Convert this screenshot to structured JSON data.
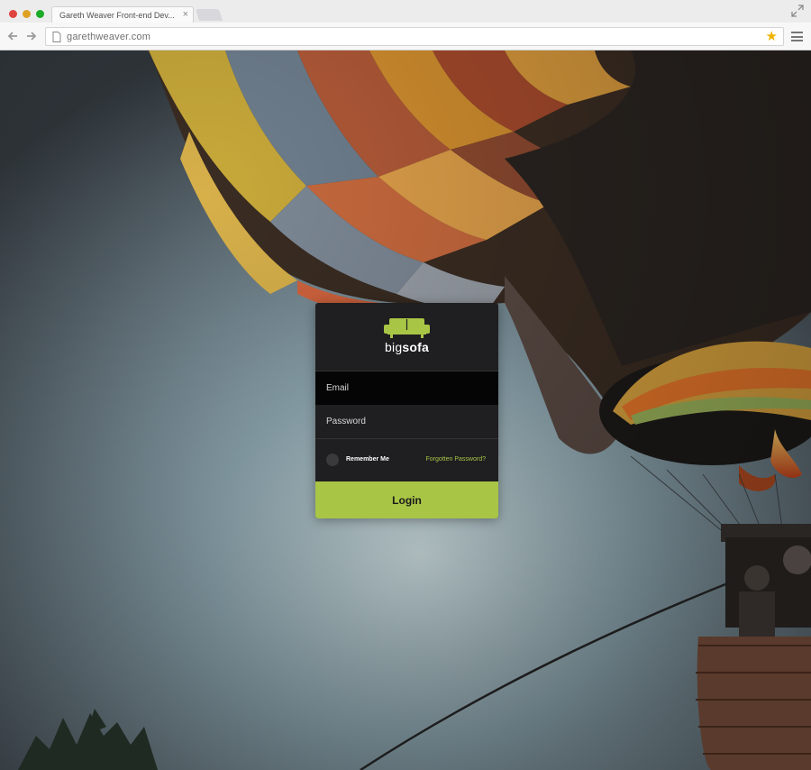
{
  "browser": {
    "tab_title": "Gareth Weaver Front-end Dev...",
    "tab_close": "×",
    "url": "garethweaver.com",
    "bookmark_icon": "star-icon",
    "star_glyph": "★",
    "accent_star": "#f0b400"
  },
  "login": {
    "brand_prefix": "big",
    "brand_suffix": "sofa",
    "email_placeholder": "Email",
    "password_placeholder": "Password",
    "remember_label": "Remember Me",
    "forgot_label": "Forgotten Password?",
    "login_label": "Login",
    "accent_color": "#a8c546",
    "card_color": "#1f1e20"
  }
}
